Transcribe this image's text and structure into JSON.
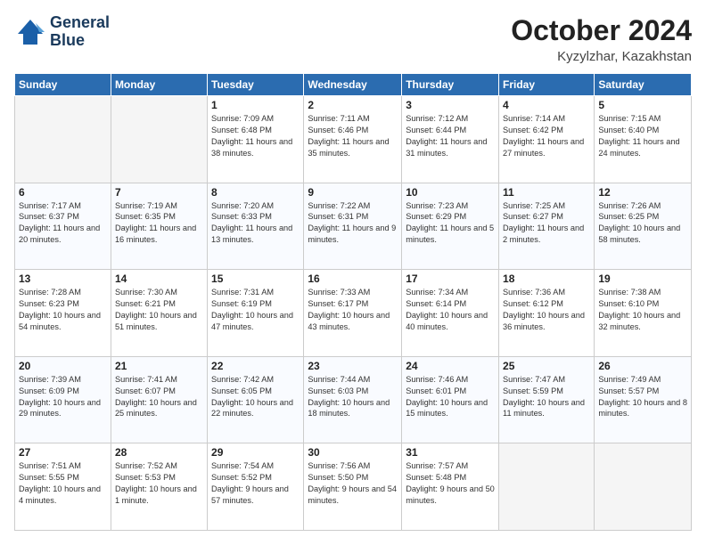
{
  "header": {
    "logo_line1": "General",
    "logo_line2": "Blue",
    "month": "October 2024",
    "location": "Kyzylzhar, Kazakhstan"
  },
  "weekdays": [
    "Sunday",
    "Monday",
    "Tuesday",
    "Wednesday",
    "Thursday",
    "Friday",
    "Saturday"
  ],
  "weeks": [
    [
      {
        "day": "",
        "empty": true
      },
      {
        "day": "",
        "empty": true
      },
      {
        "day": "1",
        "sunrise": "7:09 AM",
        "sunset": "6:48 PM",
        "daylight": "11 hours and 38 minutes."
      },
      {
        "day": "2",
        "sunrise": "7:11 AM",
        "sunset": "6:46 PM",
        "daylight": "11 hours and 35 minutes."
      },
      {
        "day": "3",
        "sunrise": "7:12 AM",
        "sunset": "6:44 PM",
        "daylight": "11 hours and 31 minutes."
      },
      {
        "day": "4",
        "sunrise": "7:14 AM",
        "sunset": "6:42 PM",
        "daylight": "11 hours and 27 minutes."
      },
      {
        "day": "5",
        "sunrise": "7:15 AM",
        "sunset": "6:40 PM",
        "daylight": "11 hours and 24 minutes."
      }
    ],
    [
      {
        "day": "6",
        "sunrise": "7:17 AM",
        "sunset": "6:37 PM",
        "daylight": "11 hours and 20 minutes."
      },
      {
        "day": "7",
        "sunrise": "7:19 AM",
        "sunset": "6:35 PM",
        "daylight": "11 hours and 16 minutes."
      },
      {
        "day": "8",
        "sunrise": "7:20 AM",
        "sunset": "6:33 PM",
        "daylight": "11 hours and 13 minutes."
      },
      {
        "day": "9",
        "sunrise": "7:22 AM",
        "sunset": "6:31 PM",
        "daylight": "11 hours and 9 minutes."
      },
      {
        "day": "10",
        "sunrise": "7:23 AM",
        "sunset": "6:29 PM",
        "daylight": "11 hours and 5 minutes."
      },
      {
        "day": "11",
        "sunrise": "7:25 AM",
        "sunset": "6:27 PM",
        "daylight": "11 hours and 2 minutes."
      },
      {
        "day": "12",
        "sunrise": "7:26 AM",
        "sunset": "6:25 PM",
        "daylight": "10 hours and 58 minutes."
      }
    ],
    [
      {
        "day": "13",
        "sunrise": "7:28 AM",
        "sunset": "6:23 PM",
        "daylight": "10 hours and 54 minutes."
      },
      {
        "day": "14",
        "sunrise": "7:30 AM",
        "sunset": "6:21 PM",
        "daylight": "10 hours and 51 minutes."
      },
      {
        "day": "15",
        "sunrise": "7:31 AM",
        "sunset": "6:19 PM",
        "daylight": "10 hours and 47 minutes."
      },
      {
        "day": "16",
        "sunrise": "7:33 AM",
        "sunset": "6:17 PM",
        "daylight": "10 hours and 43 minutes."
      },
      {
        "day": "17",
        "sunrise": "7:34 AM",
        "sunset": "6:14 PM",
        "daylight": "10 hours and 40 minutes."
      },
      {
        "day": "18",
        "sunrise": "7:36 AM",
        "sunset": "6:12 PM",
        "daylight": "10 hours and 36 minutes."
      },
      {
        "day": "19",
        "sunrise": "7:38 AM",
        "sunset": "6:10 PM",
        "daylight": "10 hours and 32 minutes."
      }
    ],
    [
      {
        "day": "20",
        "sunrise": "7:39 AM",
        "sunset": "6:09 PM",
        "daylight": "10 hours and 29 minutes."
      },
      {
        "day": "21",
        "sunrise": "7:41 AM",
        "sunset": "6:07 PM",
        "daylight": "10 hours and 25 minutes."
      },
      {
        "day": "22",
        "sunrise": "7:42 AM",
        "sunset": "6:05 PM",
        "daylight": "10 hours and 22 minutes."
      },
      {
        "day": "23",
        "sunrise": "7:44 AM",
        "sunset": "6:03 PM",
        "daylight": "10 hours and 18 minutes."
      },
      {
        "day": "24",
        "sunrise": "7:46 AM",
        "sunset": "6:01 PM",
        "daylight": "10 hours and 15 minutes."
      },
      {
        "day": "25",
        "sunrise": "7:47 AM",
        "sunset": "5:59 PM",
        "daylight": "10 hours and 11 minutes."
      },
      {
        "day": "26",
        "sunrise": "7:49 AM",
        "sunset": "5:57 PM",
        "daylight": "10 hours and 8 minutes."
      }
    ],
    [
      {
        "day": "27",
        "sunrise": "7:51 AM",
        "sunset": "5:55 PM",
        "daylight": "10 hours and 4 minutes."
      },
      {
        "day": "28",
        "sunrise": "7:52 AM",
        "sunset": "5:53 PM",
        "daylight": "10 hours and 1 minute."
      },
      {
        "day": "29",
        "sunrise": "7:54 AM",
        "sunset": "5:52 PM",
        "daylight": "9 hours and 57 minutes."
      },
      {
        "day": "30",
        "sunrise": "7:56 AM",
        "sunset": "5:50 PM",
        "daylight": "9 hours and 54 minutes."
      },
      {
        "day": "31",
        "sunrise": "7:57 AM",
        "sunset": "5:48 PM",
        "daylight": "9 hours and 50 minutes."
      },
      {
        "day": "",
        "empty": true
      },
      {
        "day": "",
        "empty": true
      }
    ]
  ]
}
